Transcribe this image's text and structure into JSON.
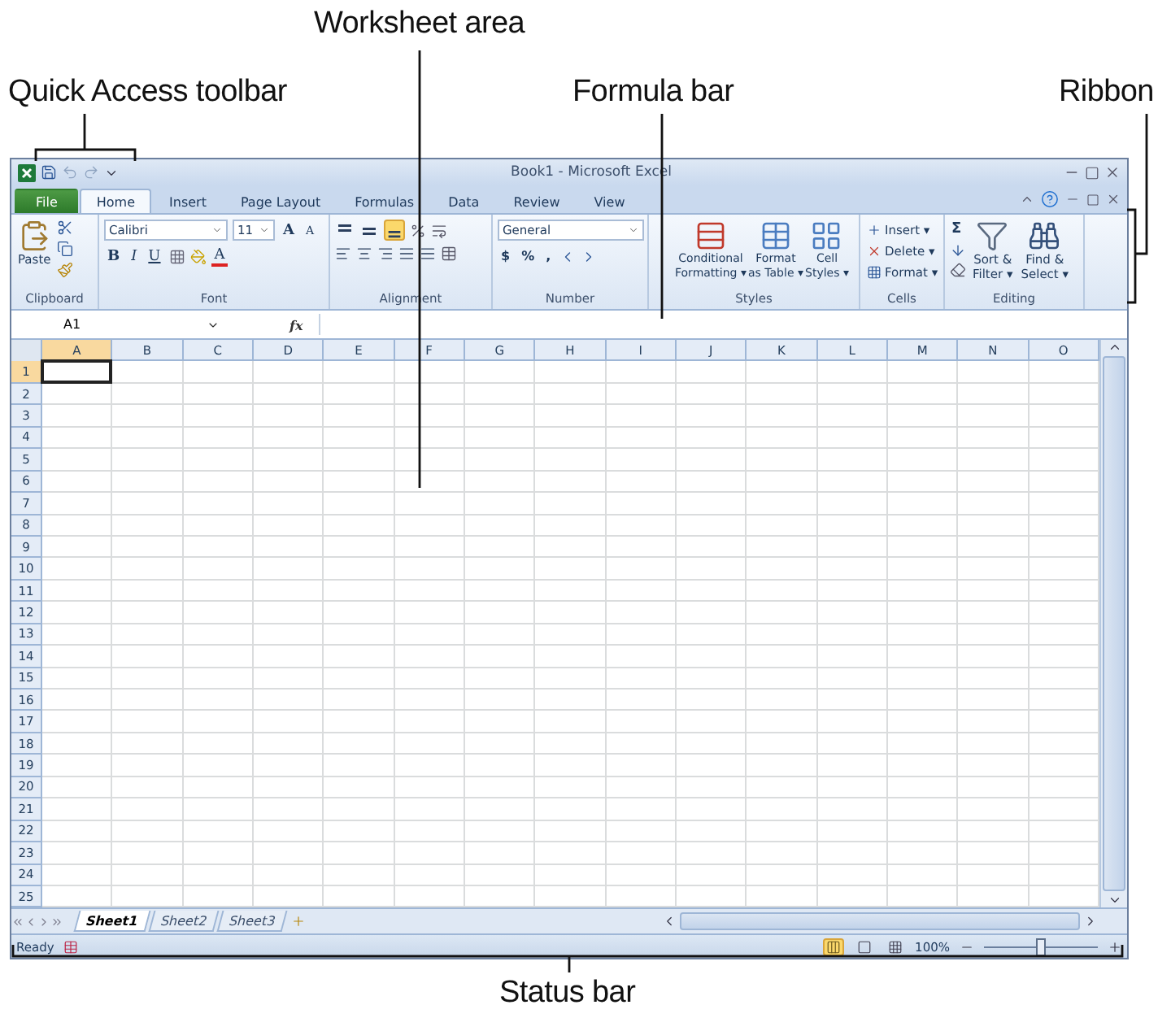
{
  "callouts": [
    {
      "label": "Worksheet area"
    },
    {
      "label": "Quick Access toolbar"
    },
    {
      "label": "Formula bar"
    },
    {
      "label": "Ribbon"
    },
    {
      "label": "Status bar"
    }
  ],
  "window": {
    "title": "Book1 - Microsoft Excel"
  },
  "tabs": [
    {
      "label": "File",
      "kind": "file",
      "selected": false
    },
    {
      "label": "Home",
      "kind": "tab",
      "selected": true
    },
    {
      "label": "Insert",
      "kind": "tab",
      "selected": false
    },
    {
      "label": "Page Layout",
      "kind": "tab",
      "selected": false
    },
    {
      "label": "Formulas",
      "kind": "tab",
      "selected": false
    },
    {
      "label": "Data",
      "kind": "tab",
      "selected": false
    },
    {
      "label": "Review",
      "kind": "tab",
      "selected": false
    },
    {
      "label": "View",
      "kind": "tab",
      "selected": false
    }
  ],
  "ribbon": {
    "clipboard": {
      "label": "Clipboard",
      "paste": "Paste"
    },
    "font": {
      "label": "Font",
      "name": "Calibri",
      "size": "11",
      "grow": "A",
      "shrink": "A",
      "styles": [
        "B",
        "I",
        "U"
      ],
      "font_color": "A"
    },
    "alignment": {
      "label": "Alignment"
    },
    "number": {
      "label": "Number",
      "format": "General",
      "symbols": [
        "$",
        "%",
        ","
      ]
    },
    "styles": {
      "label": "Styles",
      "buttons": [
        {
          "lines": [
            "Conditional",
            "Formatting ▾"
          ],
          "kind": "conditional"
        },
        {
          "lines": [
            "Format",
            "as Table ▾"
          ],
          "kind": "table"
        },
        {
          "lines": [
            "Cell",
            "Styles ▾"
          ],
          "kind": "cellstyles"
        }
      ]
    },
    "cells": {
      "label": "Cells",
      "buttons": [
        {
          "label": "Insert ▾",
          "kind": "insert"
        },
        {
          "label": "Delete ▾",
          "kind": "delete"
        },
        {
          "label": "Format ▾",
          "kind": "format"
        }
      ]
    },
    "editing": {
      "label": "Editing",
      "sum": "Σ",
      "buttons": [
        {
          "lines": [
            "Sort &",
            "Filter ▾"
          ],
          "kind": "sort"
        },
        {
          "lines": [
            "Find &",
            "Select ▾"
          ],
          "kind": "find"
        }
      ]
    }
  },
  "formula_bar": {
    "name_box": "A1",
    "fx": "fx"
  },
  "columns": [
    {
      "label": "A",
      "selected": true
    },
    {
      "label": "B",
      "selected": false
    },
    {
      "label": "C",
      "selected": false
    },
    {
      "label": "D",
      "selected": false
    },
    {
      "label": "E",
      "selected": false
    },
    {
      "label": "F",
      "selected": false
    },
    {
      "label": "G",
      "selected": false
    },
    {
      "label": "H",
      "selected": false
    },
    {
      "label": "I",
      "selected": false
    },
    {
      "label": "J",
      "selected": false
    },
    {
      "label": "K",
      "selected": false
    },
    {
      "label": "L",
      "selected": false
    },
    {
      "label": "M",
      "selected": false
    },
    {
      "label": "N",
      "selected": false
    },
    {
      "label": "O",
      "selected": false
    }
  ],
  "rows": [
    {
      "label": "1",
      "selected": true
    },
    {
      "label": "2",
      "selected": false
    },
    {
      "label": "3",
      "selected": false
    },
    {
      "label": "4",
      "selected": false
    },
    {
      "label": "5",
      "selected": false
    },
    {
      "label": "6",
      "selected": false
    },
    {
      "label": "7",
      "selected": false
    },
    {
      "label": "8",
      "selected": false
    },
    {
      "label": "9",
      "selected": false
    },
    {
      "label": "10",
      "selected": false
    },
    {
      "label": "11",
      "selected": false
    },
    {
      "label": "12",
      "selected": false
    },
    {
      "label": "13",
      "selected": false
    },
    {
      "label": "14",
      "selected": false
    },
    {
      "label": "15",
      "selected": false
    },
    {
      "label": "16",
      "selected": false
    },
    {
      "label": "17",
      "selected": false
    },
    {
      "label": "18",
      "selected": false
    },
    {
      "label": "19",
      "selected": false
    },
    {
      "label": "20",
      "selected": false
    },
    {
      "label": "21",
      "selected": false
    },
    {
      "label": "22",
      "selected": false
    },
    {
      "label": "23",
      "selected": false
    },
    {
      "label": "24",
      "selected": false
    },
    {
      "label": "25",
      "selected": false
    }
  ],
  "sheet_tabs": [
    {
      "label": "Sheet1",
      "selected": true
    },
    {
      "label": "Sheet2",
      "selected": false
    },
    {
      "label": "Sheet3",
      "selected": false
    }
  ],
  "status_bar": {
    "text": "Ready",
    "views": [
      {
        "kind": "normal",
        "selected": true
      },
      {
        "kind": "layout",
        "selected": false
      },
      {
        "kind": "pagebreak",
        "selected": false
      }
    ],
    "zoom": {
      "reading": "100%",
      "level": 0.5
    }
  }
}
